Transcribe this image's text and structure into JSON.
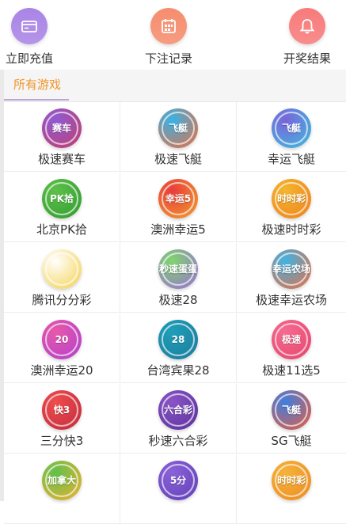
{
  "top_menu": {
    "items": [
      {
        "label": "立即充值",
        "icon": "wallet-icon",
        "color": "#a984e6"
      },
      {
        "label": "下注记录",
        "icon": "calendar-icon",
        "color": "#f58d6e"
      },
      {
        "label": "开奖结果",
        "icon": "bell-icon",
        "color": "#f77b7b"
      }
    ]
  },
  "tabs": {
    "all_games": "所有游戏",
    "active_color": "#f0952b"
  },
  "games": [
    {
      "label": "极速赛车",
      "icon_text": "赛车",
      "color1": "#8e5bd6",
      "color2": "#c43d6a"
    },
    {
      "label": "极速飞艇",
      "icon_text": "飞艇",
      "color1": "#36b3e8",
      "color2": "#ef6b3a"
    },
    {
      "label": "幸运飞艇",
      "icon_text": "飞艇",
      "color1": "#7b63d9",
      "color2": "#3bc0e0"
    },
    {
      "label": "北京PK拾",
      "icon_text": "PK拾",
      "color1": "#5ec04a",
      "color2": "#2f9a2f"
    },
    {
      "label": "澳洲幸运5",
      "icon_text": "幸运5",
      "color1": "#e83b3b",
      "color2": "#f2a12e"
    },
    {
      "label": "极速时时彩",
      "icon_text": "时时彩",
      "color1": "#f3b62d",
      "color2": "#f07f1e"
    },
    {
      "label": "腾讯分分彩",
      "icon_text": "",
      "color1": "#ffffff",
      "color2": "#f3d04a"
    },
    {
      "label": "极速28",
      "icon_text": "秒速蛋蛋",
      "color1": "#7fd66d",
      "color2": "#9b6bd8"
    },
    {
      "label": "极速幸运农场",
      "icon_text": "幸运农场",
      "color1": "#3db4e6",
      "color2": "#f06b3b"
    },
    {
      "label": "澳洲幸运20",
      "icon_text": "20",
      "color1": "#e859a8",
      "color2": "#b03fd0"
    },
    {
      "label": "台湾宾果28",
      "icon_text": "28",
      "color1": "#1e9fb8",
      "color2": "#1d7a9c"
    },
    {
      "label": "极速11选5",
      "icon_text": "极速",
      "color1": "#f56b8f",
      "color2": "#e6436e"
    },
    {
      "label": "三分快3",
      "icon_text": "快3",
      "color1": "#ef4d4d",
      "color2": "#c02a3c"
    },
    {
      "label": "秒速六合彩",
      "icon_text": "六合彩",
      "color1": "#8a55c7",
      "color2": "#5a2f9a"
    },
    {
      "label": "SG飞艇",
      "icon_text": "飞艇",
      "color1": "#3d7fe0",
      "color2": "#ef5a3a"
    },
    {
      "label": "",
      "icon_text": "加拿大",
      "color1": "#5fc14d",
      "color2": "#f2b02e"
    },
    {
      "label": "",
      "icon_text": "5分",
      "color1": "#8b62d8",
      "color2": "#5f3fb8"
    },
    {
      "label": "",
      "icon_text": "时时彩",
      "color1": "#f4b33a",
      "color2": "#ef8a22"
    }
  ]
}
